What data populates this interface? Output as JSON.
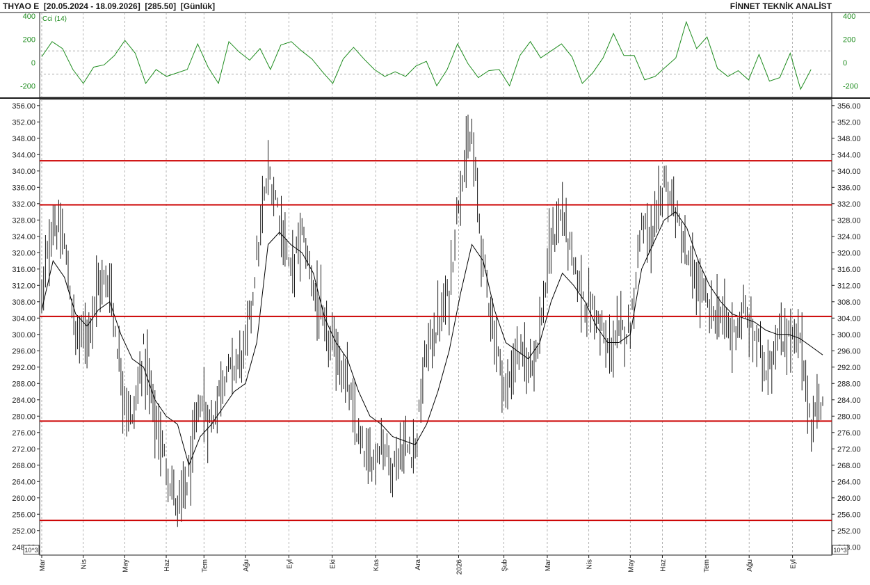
{
  "header": {
    "symbol": "THYAO E",
    "range": "[20.05.2024 - 18.09.2026]",
    "last": "[285.50]",
    "period": "[Günlük]",
    "brand": "FİNNET TEKNİK ANALİST"
  },
  "chart_data": [
    {
      "type": "line",
      "panel": "indicator",
      "series_name": "Cci (14)",
      "yticks": [
        400,
        200,
        0,
        -200
      ],
      "ylim": [
        -300,
        430
      ],
      "reference_lines": [
        100,
        -100
      ],
      "colors": {
        "line": "#1e8c1e",
        "ref": "#9a9a9a"
      },
      "x_index": [
        0,
        8,
        16,
        24,
        32,
        40,
        48,
        56,
        64,
        72,
        80,
        88,
        96,
        104,
        112,
        120,
        128,
        136,
        144,
        152,
        160,
        168,
        176,
        184,
        192,
        200,
        208,
        216,
        224,
        232,
        240,
        248,
        256,
        264,
        272,
        280,
        288,
        296,
        304,
        312,
        320,
        328,
        336,
        344,
        352,
        360,
        368,
        376,
        384,
        392,
        400,
        408,
        416,
        424,
        432,
        440,
        448,
        456,
        464,
        472,
        480,
        488,
        496,
        504,
        512,
        520,
        528,
        536,
        544,
        552,
        560,
        568,
        576,
        584,
        592
      ],
      "values": [
        50,
        180,
        120,
        -60,
        -180,
        -40,
        -20,
        60,
        190,
        80,
        -180,
        -60,
        -120,
        -90,
        -60,
        160,
        -40,
        -180,
        180,
        90,
        20,
        120,
        -60,
        150,
        180,
        100,
        30,
        -80,
        -180,
        30,
        130,
        30,
        -60,
        -120,
        -80,
        -120,
        -30,
        10,
        -200,
        -60,
        160,
        -10,
        -130,
        -70,
        -60,
        -200,
        60,
        180,
        40,
        100,
        160,
        50,
        -180,
        -90,
        40,
        250,
        60,
        60,
        -150,
        -120,
        -40,
        40,
        350,
        120,
        220,
        -50,
        -120,
        -70,
        -150,
        70,
        -160,
        -130,
        80,
        -230,
        -60
      ]
    },
    {
      "type": "line",
      "panel": "price",
      "description_series": [
        "range_bars",
        "moving_average"
      ],
      "yticks": [
        "356.00",
        "352.00",
        "348.00",
        "344.00",
        "340.00",
        "336.00",
        "332.00",
        "328.00",
        "324.00",
        "320.00",
        "316.00",
        "312.00",
        "308.00",
        "304.00",
        "300.00",
        "296.00",
        "292.00",
        "288.00",
        "284.00",
        "280.00",
        "276.00",
        "272.00",
        "268.00",
        "264.00",
        "260.00",
        "256.00",
        "252.00",
        "248.00"
      ],
      "ylim": [
        246,
        357.5
      ],
      "scale_label": "10^3",
      "horizontal_lines": [
        342.5,
        331.7,
        304.4,
        278.8,
        254.5
      ],
      "colors": {
        "bars": "#1a1a1a",
        "ma": "#000000",
        "hlines": "#cc0000",
        "grid": "#a0a0a0"
      },
      "x_labels": [
        "Mar",
        "Nis",
        "May",
        "Haz",
        "Tem",
        "Ağu",
        "Eyl",
        "Eki",
        "Kas",
        "Ara",
        "2026",
        "Şub",
        "Mar",
        "Nis",
        "May",
        "Haz",
        "Tem",
        "Ağu",
        "Eyl"
      ],
      "x_label_index": [
        0,
        22,
        44,
        66,
        86,
        108,
        131,
        154,
        177,
        199,
        221,
        245,
        268,
        290,
        312,
        329,
        352,
        375,
        398
      ],
      "x_index": [
        0,
        6,
        12,
        18,
        24,
        30,
        36,
        42,
        48,
        54,
        60,
        66,
        72,
        78,
        84,
        90,
        96,
        102,
        108,
        114,
        120,
        126,
        132,
        138,
        144,
        150,
        156,
        162,
        168,
        174,
        180,
        186,
        192,
        198,
        204,
        210,
        216,
        222,
        228,
        234,
        240,
        246,
        252,
        258,
        264,
        270,
        276,
        282,
        288,
        294,
        300,
        306,
        312,
        318,
        324,
        330,
        336,
        342,
        348,
        354,
        360,
        366,
        372,
        378,
        384,
        390,
        396,
        402,
        408,
        414
      ],
      "price_path": [
        309,
        328,
        322,
        300,
        300,
        312,
        313,
        290,
        278,
        296,
        280,
        268,
        257,
        265,
        284,
        278,
        290,
        292,
        296,
        318,
        340,
        330,
        315,
        325,
        312,
        300,
        296,
        288,
        274,
        268,
        274,
        268,
        272,
        272,
        296,
        302,
        310,
        338,
        348,
        318,
        300,
        285,
        296,
        292,
        300,
        322,
        330,
        316,
        308,
        305,
        296,
        300,
        302,
        328,
        322,
        338,
        330,
        318,
        312,
        306,
        305,
        300,
        305,
        300,
        292,
        298,
        300,
        298,
        278,
        285
      ],
      "ma_path": [
        306,
        318,
        314,
        305,
        302,
        306,
        308,
        300,
        294,
        292,
        284,
        280,
        278,
        268,
        275,
        278,
        282,
        286,
        288,
        298,
        322,
        325,
        322,
        320,
        315,
        304,
        298,
        294,
        286,
        280,
        278,
        275,
        274,
        273,
        278,
        286,
        296,
        310,
        322,
        318,
        306,
        298,
        296,
        294,
        298,
        308,
        315,
        312,
        308,
        302,
        298,
        298,
        300,
        316,
        322,
        328,
        330,
        326,
        318,
        312,
        308,
        305,
        304,
        303,
        301,
        300,
        300,
        299,
        297,
        295
      ]
    }
  ]
}
